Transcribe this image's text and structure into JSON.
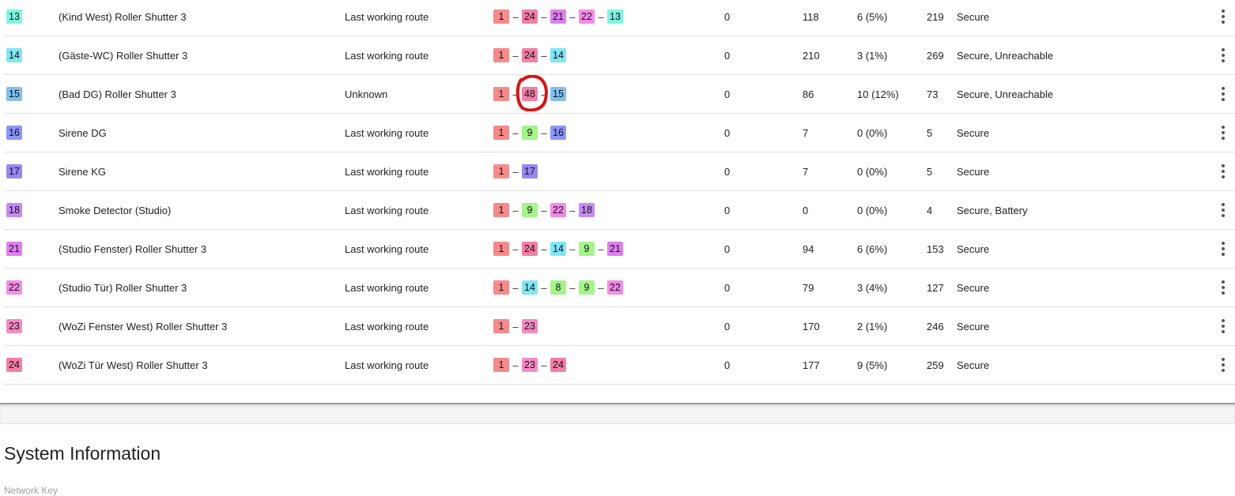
{
  "rows": [
    {
      "id": "13",
      "id_color": "#7ff5e3",
      "name": "(Kind West) Roller Shutter 3",
      "route_status": "Last working route",
      "route": [
        {
          "n": "1",
          "c": "#f58a8a"
        },
        {
          "n": "24",
          "c": "#f27fa6"
        },
        {
          "n": "21",
          "c": "#de7ff0"
        },
        {
          "n": "22",
          "c": "#f58ae9"
        },
        {
          "n": "13",
          "c": "#7ff5e3"
        }
      ],
      "v1": "0",
      "v2": "118",
      "v3": "6 (5%)",
      "v4": "219",
      "flags": "Secure"
    },
    {
      "id": "14",
      "id_color": "#7fe6f5",
      "name": "(Gäste-WC) Roller Shutter 3",
      "route_status": "Last working route",
      "route": [
        {
          "n": "1",
          "c": "#f58a8a"
        },
        {
          "n": "24",
          "c": "#f27fa6"
        },
        {
          "n": "14",
          "c": "#7fe6f5"
        }
      ],
      "v1": "0",
      "v2": "210",
      "v3": "3 (1%)",
      "v4": "269",
      "flags": "Secure, Unreachable"
    },
    {
      "id": "15",
      "id_color": "#7fbff0",
      "name": "(Bad DG) Roller Shutter 3",
      "route_status": "Unknown",
      "route": [
        {
          "n": "1",
          "c": "#f58a8a"
        },
        {
          "n": "48",
          "c": "#f27fa6"
        },
        {
          "n": "15",
          "c": "#7fbff0"
        }
      ],
      "v1": "0",
      "v2": "86",
      "v3": "10 (12%)",
      "v4": "73",
      "flags": "Secure, Unreachable"
    },
    {
      "id": "16",
      "id_color": "#8a95f5",
      "name": "Sirene DG",
      "route_status": "Last working route",
      "route": [
        {
          "n": "1",
          "c": "#f58a8a"
        },
        {
          "n": "9",
          "c": "#a3f58a"
        },
        {
          "n": "16",
          "c": "#8a95f5"
        }
      ],
      "v1": "0",
      "v2": "7",
      "v3": "0 (0%)",
      "v4": "5",
      "flags": "Secure"
    },
    {
      "id": "17",
      "id_color": "#9a86f2",
      "name": "Sirene KG",
      "route_status": "Last working route",
      "route": [
        {
          "n": "1",
          "c": "#f58a8a"
        },
        {
          "n": "17",
          "c": "#9a86f2"
        }
      ],
      "v1": "0",
      "v2": "7",
      "v3": "0 (0%)",
      "v4": "5",
      "flags": "Secure"
    },
    {
      "id": "18",
      "id_color": "#c58af5",
      "name": "Smoke Detector (Studio)",
      "route_status": "Last working route",
      "route": [
        {
          "n": "1",
          "c": "#f58a8a"
        },
        {
          "n": "9",
          "c": "#a3f58a"
        },
        {
          "n": "22",
          "c": "#f58ae9"
        },
        {
          "n": "18",
          "c": "#c58af5"
        }
      ],
      "v1": "0",
      "v2": "0",
      "v3": "0 (0%)",
      "v4": "4",
      "flags": "Secure, Battery"
    },
    {
      "id": "21",
      "id_color": "#de7ff0",
      "name": "(Studio Fenster) Roller Shutter 3",
      "route_status": "Last working route",
      "route": [
        {
          "n": "1",
          "c": "#f58a8a"
        },
        {
          "n": "24",
          "c": "#f27fa6"
        },
        {
          "n": "14",
          "c": "#7fe6f5"
        },
        {
          "n": "9",
          "c": "#a3f58a"
        },
        {
          "n": "21",
          "c": "#de7ff0"
        }
      ],
      "v1": "0",
      "v2": "94",
      "v3": "6 (6%)",
      "v4": "153",
      "flags": "Secure"
    },
    {
      "id": "22",
      "id_color": "#f58ae9",
      "name": "(Studio Tür) Roller Shutter 3",
      "route_status": "Last working route",
      "route": [
        {
          "n": "1",
          "c": "#f58a8a"
        },
        {
          "n": "14",
          "c": "#7fe6f5"
        },
        {
          "n": "8",
          "c": "#a3f58a"
        },
        {
          "n": "9",
          "c": "#a3f58a"
        },
        {
          "n": "22",
          "c": "#f58ae9"
        }
      ],
      "v1": "0",
      "v2": "79",
      "v3": "3 (4%)",
      "v4": "127",
      "flags": "Secure"
    },
    {
      "id": "23",
      "id_color": "#f58ac4",
      "name": "(WoZi Fenster West) Roller Shutter 3",
      "route_status": "Last working route",
      "route": [
        {
          "n": "1",
          "c": "#f58a8a"
        },
        {
          "n": "23",
          "c": "#f58ac4"
        }
      ],
      "v1": "0",
      "v2": "170",
      "v3": "2 (1%)",
      "v4": "246",
      "flags": "Secure"
    },
    {
      "id": "24",
      "id_color": "#f27fa6",
      "name": "(WoZi Tür West) Roller Shutter 3",
      "route_status": "Last working route",
      "route": [
        {
          "n": "1",
          "c": "#f58a8a"
        },
        {
          "n": "23",
          "c": "#f58ac4"
        },
        {
          "n": "24",
          "c": "#f27fa6"
        }
      ],
      "v1": "0",
      "v2": "177",
      "v3": "9 (5%)",
      "v4": "259",
      "flags": "Secure"
    }
  ],
  "menu_icon": "more-vertical-icon",
  "annotation_color": "#e01010",
  "section": {
    "title": "System Information",
    "subtitle": "Network Key"
  }
}
